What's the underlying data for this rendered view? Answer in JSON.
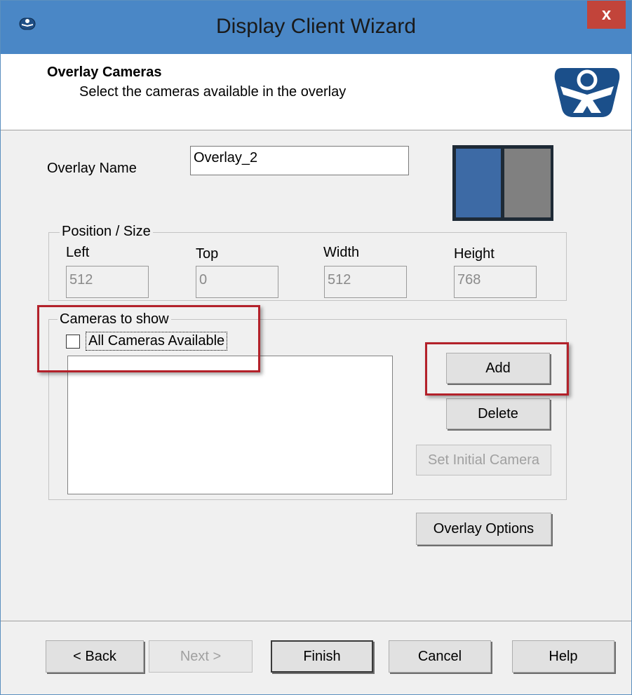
{
  "window": {
    "title": "Display Client Wizard",
    "close_label": "x",
    "icon": "thinmanager-icon"
  },
  "header": {
    "title": "Overlay Cameras",
    "subtitle": "Select the cameras available in the overlay",
    "logo": "thinmanager-logo-icon"
  },
  "overlay_name": {
    "label": "Overlay Name",
    "value": "Overlay_2"
  },
  "position_size": {
    "legend": "Position / Size",
    "fields": [
      {
        "label": "Left",
        "value": "512"
      },
      {
        "label": "Top",
        "value": "0"
      },
      {
        "label": "Width",
        "value": "512"
      },
      {
        "label": "Height",
        "value": "768"
      }
    ]
  },
  "cameras": {
    "legend": "Cameras to show",
    "all_cameras_label": "All Cameras Available",
    "all_cameras_checked": false,
    "items": [],
    "add_label": "Add",
    "delete_label": "Delete",
    "set_initial_label": "Set Initial Camera"
  },
  "overlay_options_label": "Overlay Options",
  "footer": {
    "back_label": "< Back",
    "next_label": "Next >",
    "finish_label": "Finish",
    "cancel_label": "Cancel",
    "help_label": "Help"
  },
  "colors": {
    "highlight": "#b3212a",
    "title_bar": "#4a87c6",
    "preview_left": "#3d6aa5",
    "preview_right": "#808080"
  }
}
